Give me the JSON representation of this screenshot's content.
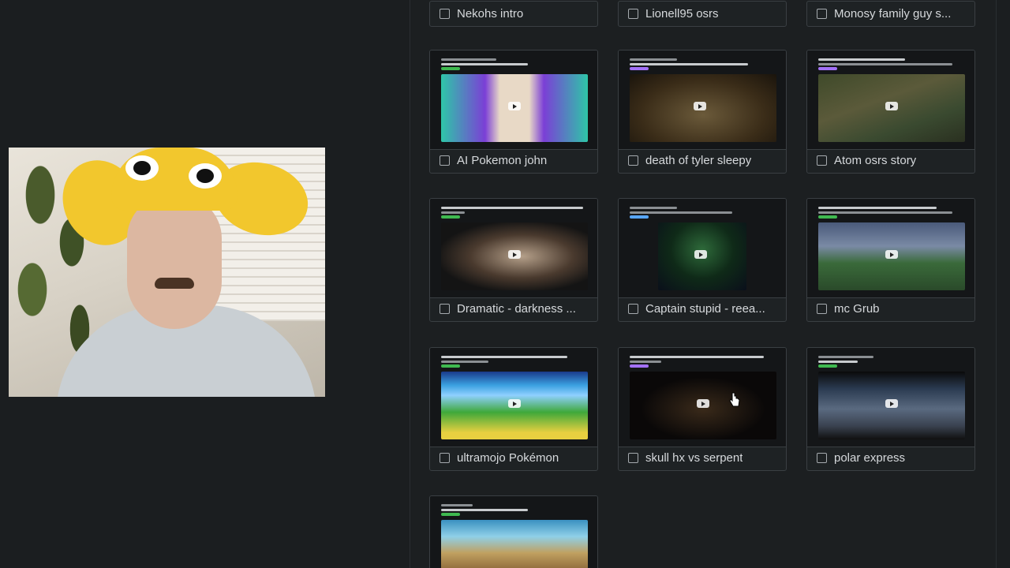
{
  "cards": [
    {
      "label": "Nekohs intro"
    },
    {
      "label": "Lionell95 osrs"
    },
    {
      "label": "Monosy family guy s..."
    },
    {
      "label": "AI Pokemon john"
    },
    {
      "label": "death of tyler sleepy"
    },
    {
      "label": "Atom osrs story"
    },
    {
      "label": "Dramatic - darkness ..."
    },
    {
      "label": "Captain stupid - reea..."
    },
    {
      "label": "mc Grub"
    },
    {
      "label": "ultramojo Pokémon"
    },
    {
      "label": "skull hx vs serpent"
    },
    {
      "label": "polar express"
    },
    {
      "label": ""
    }
  ],
  "colors": {
    "background": "#1b1e20",
    "card_border": "#3a3f43",
    "label_text": "#d6d9dc",
    "tag_green": "#3fb950",
    "tag_purple": "#a371f7"
  }
}
